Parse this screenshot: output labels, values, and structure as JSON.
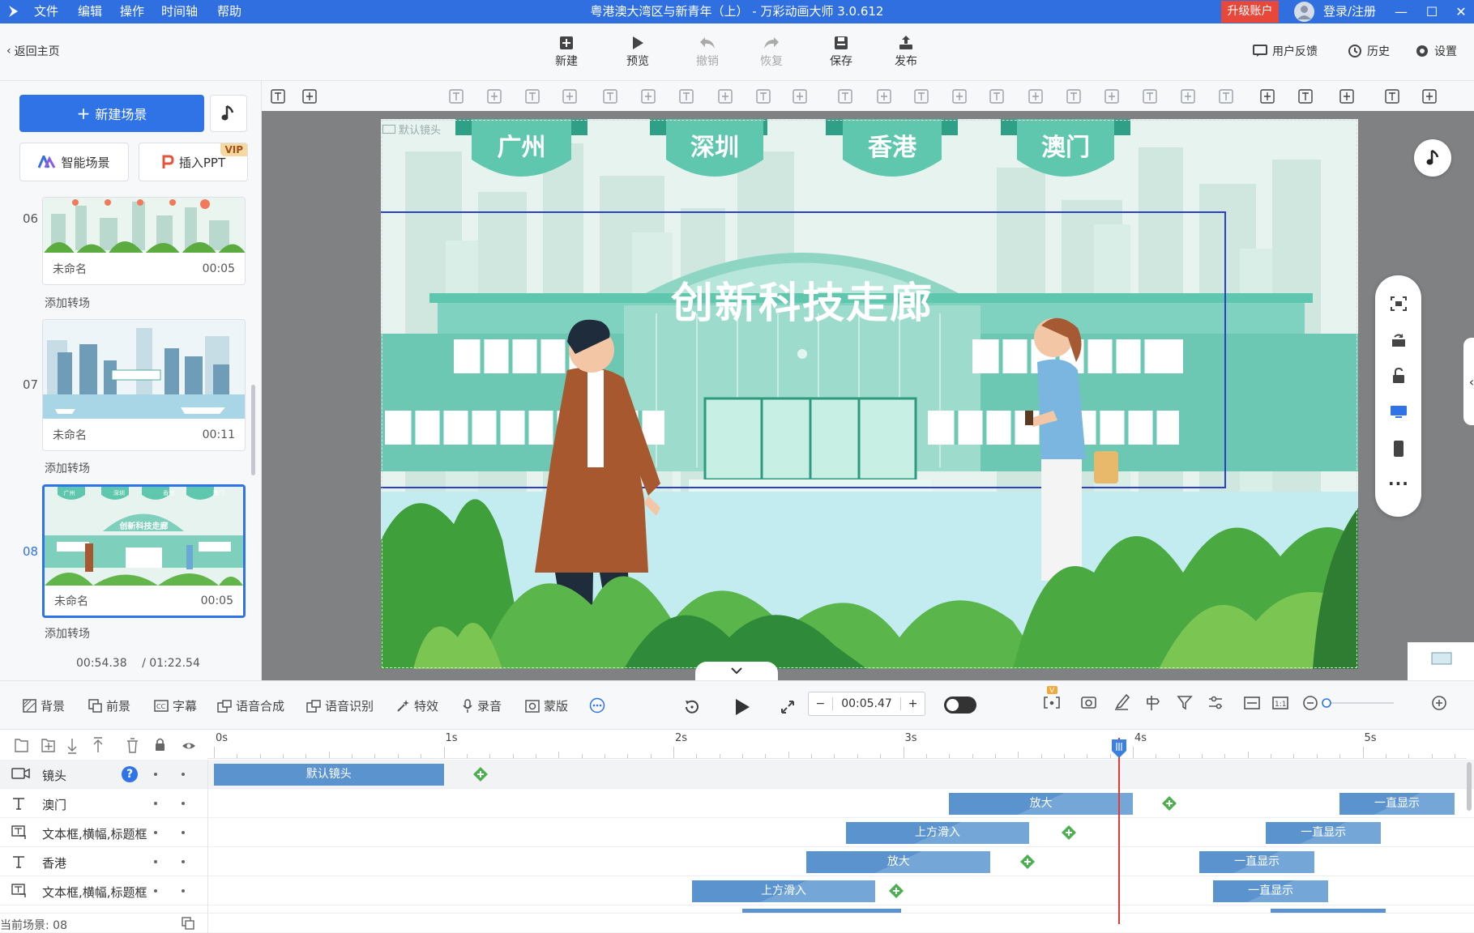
{
  "titlebar": {
    "menus": [
      "文件",
      "编辑",
      "操作",
      "时间轴",
      "帮助"
    ],
    "title": "粤港澳大湾区与新青年（上） - 万彩动画大师 3.0.612",
    "upgrade": "升级账户",
    "login": "登录/注册"
  },
  "toolbar": {
    "back": "返回主页",
    "buttons": [
      {
        "label": "新建",
        "icon": "plus-box-icon"
      },
      {
        "label": "预览",
        "icon": "play-icon"
      },
      {
        "label": "撤销",
        "icon": "undo-icon"
      },
      {
        "label": "恢复",
        "icon": "redo-icon"
      },
      {
        "label": "保存",
        "icon": "save-icon"
      },
      {
        "label": "发布",
        "icon": "publish-icon"
      }
    ],
    "right": [
      "用户反馈",
      "历史",
      "设置"
    ]
  },
  "leftpanel": {
    "new_scene": "新建场景",
    "smart_scene": "智能场景",
    "insert_ppt": "插入PPT",
    "vip": "VIP",
    "add_transition": "添加转场",
    "scenes": [
      {
        "num": "06",
        "name": "未命名",
        "duration": "00:05"
      },
      {
        "num": "07",
        "name": "未命名",
        "duration": "00:11"
      },
      {
        "num": "08",
        "name": "未命名",
        "duration": "00:05"
      }
    ],
    "time_current": "00:54.38",
    "time_total": "/ 01:22.54"
  },
  "canvas": {
    "default_camera": "默认镜头",
    "banners": [
      "广州",
      "深圳",
      "香港",
      "澳门"
    ],
    "building_title": "创新科技走廊",
    "thumb_building_title": "创新科技走廊"
  },
  "controls": {
    "left": [
      "背景",
      "前景",
      "字幕",
      "语音合成",
      "语音识别",
      "特效",
      "录音",
      "蒙版"
    ],
    "time": "00:05.47",
    "minus": "−",
    "plus": "+"
  },
  "timeline": {
    "ruler": [
      "0s",
      "1s",
      "2s",
      "3s",
      "4s",
      "5s"
    ],
    "rows": [
      {
        "name": "镜头",
        "icon": "camera-icon"
      },
      {
        "name": "澳门",
        "icon": "text-icon"
      },
      {
        "name": "文本框,横幅,标题框",
        "icon": "textbox-icon"
      },
      {
        "name": "香港",
        "icon": "text-icon"
      },
      {
        "name": "文本框,横幅,标题框",
        "icon": "textbox-icon"
      }
    ],
    "clips": [
      {
        "row": 0,
        "label": "默认镜头",
        "start": 0.0,
        "end": 1.0,
        "style": "solid"
      },
      {
        "row": 1,
        "label": "放大",
        "start": 3.2,
        "end": 4.0,
        "style": "d"
      },
      {
        "row": 1,
        "label": "一直显示",
        "start": 4.9,
        "end": 5.4,
        "style": "d"
      },
      {
        "row": 2,
        "label": "上方滑入",
        "start": 2.75,
        "end": 3.55,
        "style": "d"
      },
      {
        "row": 2,
        "label": "一直显示",
        "start": 4.58,
        "end": 5.08,
        "style": "d"
      },
      {
        "row": 3,
        "label": "放大",
        "start": 2.58,
        "end": 3.38,
        "style": "d"
      },
      {
        "row": 3,
        "label": "一直显示",
        "start": 4.29,
        "end": 4.79,
        "style": "d"
      },
      {
        "row": 4,
        "label": "上方滑入",
        "start": 2.08,
        "end": 2.88,
        "style": "d"
      },
      {
        "row": 4,
        "label": "一直显示",
        "start": 4.35,
        "end": 4.85,
        "style": "d"
      }
    ],
    "keyframes": [
      {
        "row": 0,
        "t": 1.16
      },
      {
        "row": 1,
        "t": 4.16
      },
      {
        "row": 2,
        "t": 3.72
      },
      {
        "row": 3,
        "t": 3.54
      },
      {
        "row": 4,
        "t": 2.97
      }
    ],
    "playhead": 3.94,
    "status": "当前场景: 08"
  },
  "colors": {
    "accent": "#2f73e6",
    "titlebar": "#2f6fe0",
    "teal": "#5ec7ad",
    "clip": "#5b93cf",
    "keyframe": "#4caf50",
    "playhead": "#e53935"
  }
}
